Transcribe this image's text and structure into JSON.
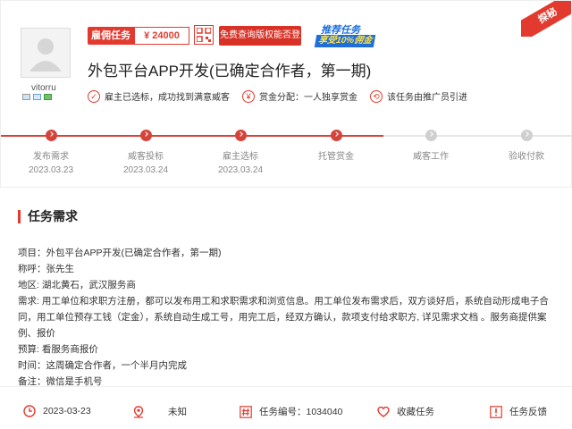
{
  "corner_badge": "探秘",
  "user": {
    "name": "vitorru"
  },
  "task": {
    "type_tag": "雇佣任务",
    "price": "¥ 24000",
    "free_check_label": "免费查询版权能否登记",
    "promo_line1": "推荐任务",
    "promo_line2": "享受10%佣金",
    "title": "外包平台APP开发(已确定合作者，第一期)"
  },
  "status": [
    {
      "icon": "check-icon",
      "glyph": "✓",
      "text": "雇主已选标，成功找到满意威客"
    },
    {
      "icon": "money-icon",
      "glyph": "¥",
      "text": "赏金分配：一人独享赏金"
    },
    {
      "icon": "share-icon",
      "glyph": "⟲",
      "text": "该任务由推广员引进"
    }
  ],
  "steps": [
    {
      "label": "发布需求",
      "date": "2023.03.23",
      "state": "done"
    },
    {
      "label": "威客投标",
      "date": "2023.03.24",
      "state": "done"
    },
    {
      "label": "雇主选标",
      "date": "2023.03.24",
      "state": "done"
    },
    {
      "label": "托管赏金",
      "date": "",
      "state": "done"
    },
    {
      "label": "威客工作",
      "date": "",
      "state": "todo"
    },
    {
      "label": "验收付款",
      "date": "",
      "state": "todo"
    }
  ],
  "requirements": {
    "title": "任务需求",
    "lines": [
      "项目：外包平台APP开发(已确定合作者，第一期)",
      "称呼：张先生",
      "地区: 湖北黄石，武汉服务商",
      "需求: 用工单位和求职方注册，都可以发布用工和求职需求和浏览信息。用工单位发布需求后，双方谈好后，系统自动形成电子合同，用工单位预存工钱（定金），系统自动生成工号，用完工后，经双方确认，款项支付给求职方, 详见需求文档 。服务商提供案例、报价",
      "预算: 看服务商报价",
      "时间：这周确定合作者，一个半月内完成",
      "备注：微信是手机号"
    ]
  },
  "footer": {
    "date": "2023-03-23",
    "location": "未知",
    "task_no": "任务编号：1034040",
    "favorite": "收藏任务",
    "feedback": "任务反馈"
  },
  "colors": {
    "accent": "#e23a2e",
    "promo_blue": "#1e6fd9",
    "promo_yellow": "#ffe04a"
  }
}
